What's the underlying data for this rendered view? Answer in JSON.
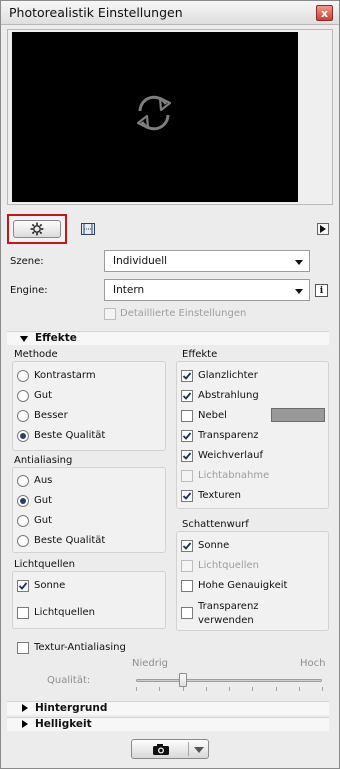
{
  "window": {
    "title": "Photorealistik Einstellungen",
    "close_glyph": "x"
  },
  "preview": {
    "icon": "refresh-icon"
  },
  "tabs": {
    "settings_icon": "gear-icon",
    "view_icon": "frame-icon",
    "more_icon": "arrow-right-icon"
  },
  "scene": {
    "label": "Szene:",
    "value": "Individuell"
  },
  "engine": {
    "label": "Engine:",
    "value": "Intern",
    "info_glyph": "i"
  },
  "detailed": {
    "label": "Detaillierte Einstellungen",
    "checked": false,
    "disabled": true
  },
  "effects_section": {
    "title": "Effekte",
    "methode": {
      "title": "Methode",
      "options": [
        {
          "label": "Kontrastarm",
          "selected": false
        },
        {
          "label": "Gut",
          "selected": false
        },
        {
          "label": "Besser",
          "selected": false
        },
        {
          "label": "Beste Qualität",
          "selected": true
        }
      ]
    },
    "antialiasing": {
      "title": "Antialiasing",
      "options": [
        {
          "label": "Aus",
          "selected": false
        },
        {
          "label": "Gut",
          "selected": true
        },
        {
          "label": "Gut",
          "selected": false
        },
        {
          "label": "Beste Qualität",
          "selected": false
        }
      ]
    },
    "lichtquellen": {
      "title": "Lichtquellen",
      "items": [
        {
          "label": "Sonne",
          "checked": true
        },
        {
          "label": "Lichtquellen",
          "checked": false
        }
      ]
    },
    "effekte": {
      "title": "Effekte",
      "items": [
        {
          "label": "Glanzlichter",
          "checked": true,
          "disabled": false
        },
        {
          "label": "Abstrahlung",
          "checked": true,
          "disabled": false
        },
        {
          "label": "Nebel",
          "checked": false,
          "disabled": false
        },
        {
          "label": "Transparenz",
          "checked": true,
          "disabled": false
        },
        {
          "label": "Weichverlauf",
          "checked": true,
          "disabled": false
        },
        {
          "label": "Lichtabnahme",
          "checked": false,
          "disabled": true
        },
        {
          "label": "Texturen",
          "checked": true,
          "disabled": false
        }
      ],
      "fog_color": "#999999"
    },
    "schattenwurf": {
      "title": "Schattenwurf",
      "items": [
        {
          "label": "Sonne",
          "checked": true,
          "disabled": false
        },
        {
          "label": "Lichtquellen",
          "checked": false,
          "disabled": true
        },
        {
          "label": "Hohe Genauigkeit",
          "checked": false,
          "disabled": false
        },
        {
          "label": "Transparenz",
          "label2": "verwenden",
          "checked": false,
          "disabled": false
        }
      ]
    },
    "textur_antialiasing": {
      "label": "Textur-Antialiasing",
      "checked": false
    },
    "quality": {
      "low": "Niedrig",
      "high": "Hoch",
      "label": "Qualität:",
      "level": 0.25
    }
  },
  "collapsed_sections": {
    "hintergrund": "Hintergrund",
    "helligkeit": "Helligkeit"
  },
  "bottom_button": {
    "icon": "camera-icon",
    "menu_icon": "chevron-down-icon"
  },
  "colors": {
    "highlight_border": "#c4161c",
    "radio_dot": "#2a3f6a"
  }
}
